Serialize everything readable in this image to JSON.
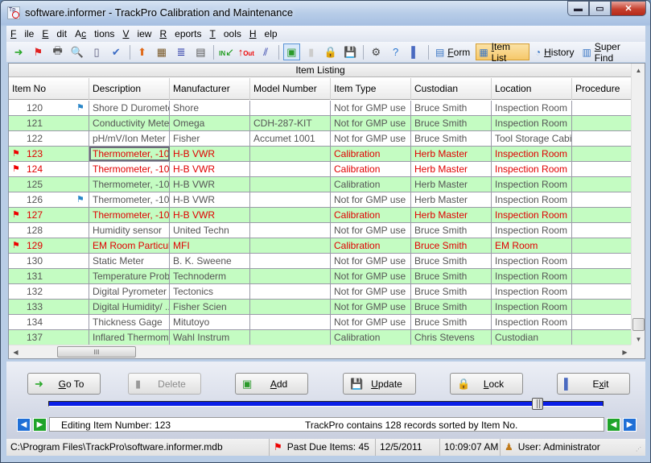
{
  "window": {
    "title": "software.informer - TrackPro Calibration and Maintenance",
    "app_icon": "trackpro-icon",
    "controls": [
      "minimize",
      "maximize",
      "close"
    ]
  },
  "menu": [
    {
      "label": "File",
      "accel": "F"
    },
    {
      "label": "Edit",
      "accel": "E"
    },
    {
      "label": "Actions",
      "accel": "c"
    },
    {
      "label": "View",
      "accel": "V"
    },
    {
      "label": "Reports",
      "accel": "R"
    },
    {
      "label": "Tools",
      "accel": "T"
    },
    {
      "label": "Help",
      "accel": "H"
    }
  ],
  "toolbar": {
    "icons": [
      {
        "name": "goto-icon",
        "glyph": "➜",
        "color": "#2aa82a"
      },
      {
        "name": "flag-icon",
        "glyph": "⚑",
        "color": "#e02020"
      },
      {
        "name": "print-icon",
        "glyph": "🖶",
        "color": "#555"
      },
      {
        "name": "search-icon",
        "glyph": "🔍",
        "color": "#3a76c4"
      },
      {
        "name": "page-icon",
        "glyph": "▯",
        "color": "#557"
      },
      {
        "name": "spellcheck-icon",
        "glyph": "✔",
        "color": "#3a6bc4"
      },
      {
        "name": "stamp-icon",
        "glyph": "⬆",
        "color": "#e06a1a"
      },
      {
        "name": "film-icon",
        "glyph": "▦",
        "color": "#7a5a2a"
      },
      {
        "name": "list-icon",
        "glyph": "≣",
        "color": "#1a2aa0"
      },
      {
        "name": "document-icon",
        "glyph": "▤",
        "color": "#555"
      },
      {
        "name": "check-in-icon",
        "glyph": "↙",
        "color": "#1a9a1a"
      },
      {
        "name": "check-out-icon",
        "glyph": "↑",
        "color": "#e00000"
      },
      {
        "name": "chart-icon",
        "glyph": "⫽",
        "color": "#1a2aa0"
      },
      {
        "name": "add-record-icon",
        "glyph": "▣",
        "color": "#2a9a2a"
      },
      {
        "name": "delete-record-icon",
        "glyph": "▮",
        "color": "#ccc"
      },
      {
        "name": "lock-icon",
        "glyph": "🔒",
        "color": "#d8a020"
      },
      {
        "name": "save-icon",
        "glyph": "💾",
        "color": "#2a5aa0"
      },
      {
        "name": "settings-icon",
        "glyph": "⚙",
        "color": "#444"
      },
      {
        "name": "help-icon",
        "glyph": "?",
        "color": "#2a76d0"
      },
      {
        "name": "exit-door-icon",
        "glyph": "▌",
        "color": "#4a6ac0"
      }
    ],
    "views": [
      {
        "label": "Form",
        "accel": "F",
        "icon": "form-icon",
        "active": false
      },
      {
        "label": "Item List",
        "accel": "I",
        "icon": "item-list-icon",
        "active": true
      },
      {
        "label": "History",
        "accel": "H",
        "icon": "history-icon",
        "active": false
      },
      {
        "label": "Super Find",
        "accel": "S",
        "icon": "super-find-icon",
        "active": false
      }
    ]
  },
  "grid": {
    "title": "Item Listing",
    "columns": [
      "Item No",
      "Description",
      "Manufacturer",
      "Model Number",
      "Item Type",
      "Custodian",
      "Location",
      "Procedure"
    ],
    "rows": [
      {
        "item_no": "120",
        "flag": "blue",
        "status": "normal",
        "description": "Shore D Durometer",
        "manufacturer": "Shore",
        "model": "",
        "type": "Not for GMP use",
        "custodian": "Bruce Smith",
        "location": "Inspection Room",
        "procedure": ""
      },
      {
        "item_no": "121",
        "flag": "",
        "status": "normal",
        "description": "Conductivity Meter",
        "manufacturer": "Omega",
        "model": "CDH-287-KIT",
        "type": "Not for GMP use",
        "custodian": "Bruce Smith",
        "location": "Inspection Room",
        "procedure": ""
      },
      {
        "item_no": "122",
        "flag": "",
        "status": "normal",
        "description": "pH/mV/Ion Meter",
        "manufacturer": "Fisher",
        "model": "Accumet 1001",
        "type": "Not for GMP use",
        "custodian": "Bruce Smith",
        "location": "Tool Storage Cabi...",
        "procedure": ""
      },
      {
        "item_no": "123",
        "flag": "red",
        "status": "past-due",
        "description": "Thermometer, -10...",
        "manufacturer": "H-B   VWR",
        "model": "",
        "type": "Calibration",
        "custodian": "Herb Master",
        "location": "Inspection Room",
        "procedure": "",
        "selected": true
      },
      {
        "item_no": "124",
        "flag": "red",
        "status": "past-due",
        "description": "Thermometer, -10...",
        "manufacturer": "H-B   VWR",
        "model": "",
        "type": "Calibration",
        "custodian": "Herb Master",
        "location": "Inspection Room",
        "procedure": ""
      },
      {
        "item_no": "125",
        "flag": "",
        "status": "normal",
        "description": "Thermometer, -10...",
        "manufacturer": "H-B   VWR",
        "model": "",
        "type": "Calibration",
        "custodian": "Herb Master",
        "location": "Inspection Room",
        "procedure": ""
      },
      {
        "item_no": "126",
        "flag": "blue",
        "status": "normal",
        "description": "Thermometer, -10...",
        "manufacturer": "H-B   VWR",
        "model": "",
        "type": "Not for GMP use",
        "custodian": "Herb Master",
        "location": "Inspection Room",
        "procedure": ""
      },
      {
        "item_no": "127",
        "flag": "red",
        "status": "past-due",
        "description": "Thermometer, -10...",
        "manufacturer": "H-B   VWR",
        "model": "",
        "type": "Calibration",
        "custodian": "Herb Master",
        "location": "Inspection Room",
        "procedure": ""
      },
      {
        "item_no": "128",
        "flag": "",
        "status": "normal",
        "description": "Humidity sensor",
        "manufacturer": "United Techn",
        "model": "",
        "type": "Not for GMP use",
        "custodian": "Bruce Smith",
        "location": "Inspection Room",
        "procedure": ""
      },
      {
        "item_no": "129",
        "flag": "red",
        "status": "past-due",
        "description": "EM Room Particul...",
        "manufacturer": "MFI",
        "model": "",
        "type": "Calibration",
        "custodian": "Bruce Smith",
        "location": "EM Room",
        "procedure": ""
      },
      {
        "item_no": "130",
        "flag": "",
        "status": "normal",
        "description": "Static Meter",
        "manufacturer": "B. K. Sweene",
        "model": "",
        "type": "Not for GMP use",
        "custodian": "Bruce Smith",
        "location": "Inspection Room",
        "procedure": ""
      },
      {
        "item_no": "131",
        "flag": "",
        "status": "normal",
        "description": "Temperature Prob...",
        "manufacturer": "Technoderm",
        "model": "",
        "type": "Not for GMP use",
        "custodian": "Bruce Smith",
        "location": "Inspection Room",
        "procedure": ""
      },
      {
        "item_no": "132",
        "flag": "",
        "status": "normal",
        "description": "Digital Pyrometer",
        "manufacturer": "Tectonics",
        "model": "",
        "type": "Not for GMP use",
        "custodian": "Bruce Smith",
        "location": "Inspection Room",
        "procedure": ""
      },
      {
        "item_no": "133",
        "flag": "",
        "status": "normal",
        "description": "Digital Humidity/ ...",
        "manufacturer": "Fisher Scien",
        "model": "",
        "type": "Not for GMP use",
        "custodian": "Bruce Smith",
        "location": "Inspection Room",
        "procedure": ""
      },
      {
        "item_no": "134",
        "flag": "",
        "status": "normal",
        "description": "Thickness Gage",
        "manufacturer": "Mitutoyo",
        "model": "",
        "type": "Not for GMP use",
        "custodian": "Bruce Smith",
        "location": "Inspection Room",
        "procedure": ""
      },
      {
        "item_no": "137",
        "flag": "",
        "status": "normal",
        "description": "Inflared Thermom...",
        "manufacturer": "Wahl Instrum",
        "model": "",
        "type": "Calibration",
        "custodian": "Chris Stevens",
        "location": "Custodian",
        "procedure": ""
      }
    ],
    "colors": {
      "alt_row": "#c4fcc2",
      "past_due_text": "#e00000",
      "normal_text": "#555555"
    }
  },
  "actions": [
    {
      "label": "Go To",
      "accel": "G",
      "icon": "goto-icon",
      "enabled": true
    },
    {
      "label": "Delete",
      "accel": "",
      "icon": "delete-icon",
      "enabled": false
    },
    {
      "label": "Add",
      "accel": "A",
      "icon": "add-icon",
      "enabled": true
    },
    {
      "label": "Update",
      "accel": "U",
      "icon": "update-icon",
      "enabled": true
    },
    {
      "label": "Lock",
      "accel": "L",
      "icon": "lock-icon",
      "enabled": true
    },
    {
      "label": "Exit",
      "accel": "x",
      "icon": "exit-icon",
      "enabled": true
    }
  ],
  "record_slider": {
    "position_fraction": 0.89
  },
  "info": {
    "editing": "Editing Item Number: 123",
    "summary": "TrackPro contains 128 records sorted by Item No."
  },
  "status": {
    "db_path": "C:\\Program Files\\TrackPro\\software.informer.mdb",
    "past_due": "Past Due Items: 45",
    "date": "12/5/2011",
    "time": "10:09:07 AM",
    "user": "User: Administrator"
  }
}
